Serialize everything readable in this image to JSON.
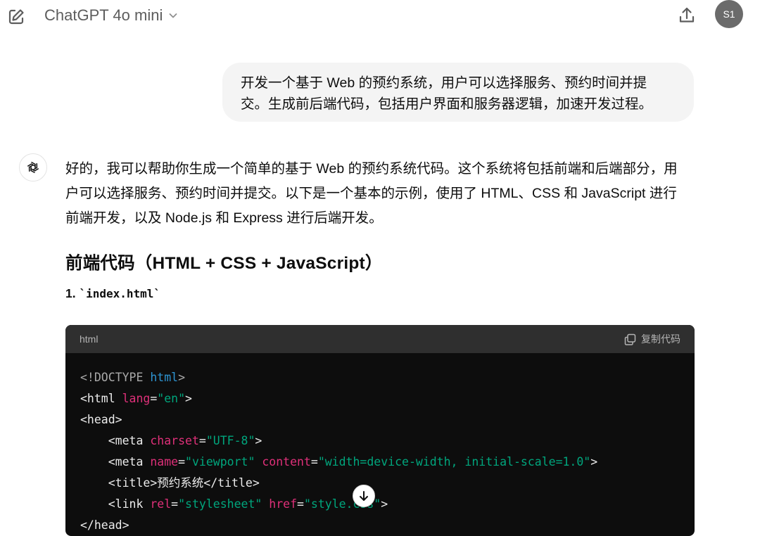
{
  "header": {
    "model_name": "ChatGPT 4o mini",
    "avatar_initials": "S1"
  },
  "user_message": {
    "line1": "开发一个基于 Web 的预约系统，用户可以选择服务、预约时间并提",
    "line2": "交。生成前后端代码，包括用户界面和服务器逻辑，加速开发过程。"
  },
  "assistant": {
    "intro_line1": "好的，我可以帮助你生成一个简单的基于 Web 的预约系统代码。这个系统将包括前端和后端部分，用",
    "intro_line2": "户可以选择服务、预约时间并提交。以下是一个基本的示例，使用了 HTML、CSS 和 JavaScript 进行",
    "intro_line3": "前端开发，以及 Node.js 和 Express 进行后端开发。",
    "heading": "前端代码（HTML + CSS + JavaScript）",
    "step_number": "1. ",
    "step_file": "`index.html`"
  },
  "code_block": {
    "language": "html",
    "copy_label": "复制代码",
    "t_doctype": "<!DOCTYPE",
    "t_html_kw": "html",
    "t_gt": ">",
    "t_html_open": "<html",
    "a_lang": "lang",
    "eq": "=",
    "s_en": "\"en\"",
    "t_head_open": "<head>",
    "t_meta": "<meta",
    "a_charset": "charset",
    "s_utf8": "\"UTF-8\"",
    "a_name": "name",
    "s_viewport": "\"viewport\"",
    "a_content": "content",
    "s_content": "\"width=device-width, initial-scale=1.0\"",
    "t_title_line": "<title>预约系统</title>",
    "t_link": "<link",
    "a_rel": "rel",
    "s_stylesheet": "\"stylesheet\"",
    "a_href": "href",
    "s_style": "\"style.css\"",
    "t_head_close": "</head>"
  }
}
